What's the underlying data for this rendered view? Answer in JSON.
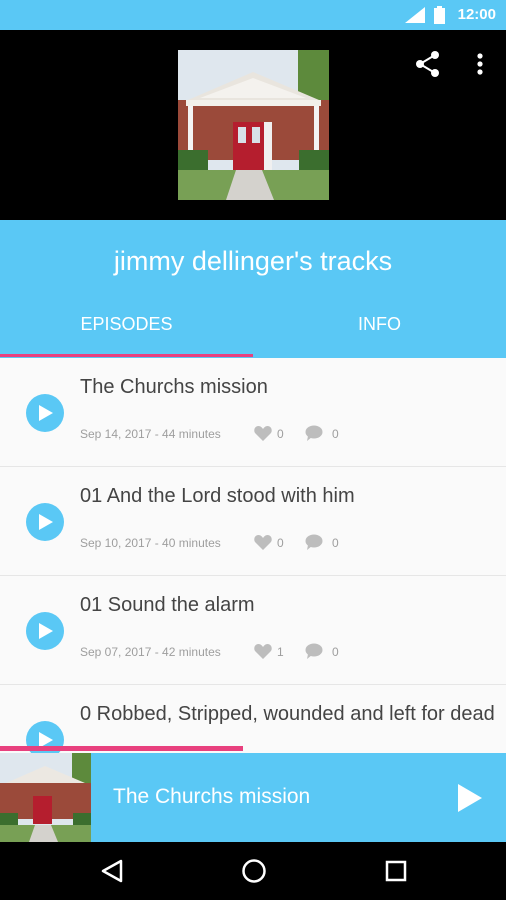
{
  "status_bar": {
    "time": "12:00"
  },
  "header": {
    "podcast_title": "jimmy dellinger's tracks",
    "cover_icon": "church-photo",
    "actions": [
      "share-icon",
      "more-vert-icon"
    ]
  },
  "tabs": [
    {
      "label": "EPISODES",
      "selected": true
    },
    {
      "label": "INFO",
      "selected": false
    }
  ],
  "episodes": [
    {
      "title": "The Churchs mission",
      "meta": "Sep 14, 2017 - 44 minutes",
      "likes": "0",
      "comments": "0"
    },
    {
      "title": "01 And the Lord stood with him",
      "meta": "Sep 10, 2017 - 40 minutes",
      "likes": "0",
      "comments": "0"
    },
    {
      "title": "01 Sound the alarm",
      "meta": "Sep 07, 2017 - 42 minutes",
      "likes": "1",
      "comments": "0"
    },
    {
      "title": "0 Robbed, Stripped, wounded and left for dead",
      "meta": "",
      "likes": "",
      "comments": ""
    }
  ],
  "player": {
    "now_playing": "The Churchs mission",
    "progress_percent": 48
  },
  "colors": {
    "accent": "#5ac8f5",
    "indicator": "#e8407e",
    "background": "#fafafa"
  }
}
